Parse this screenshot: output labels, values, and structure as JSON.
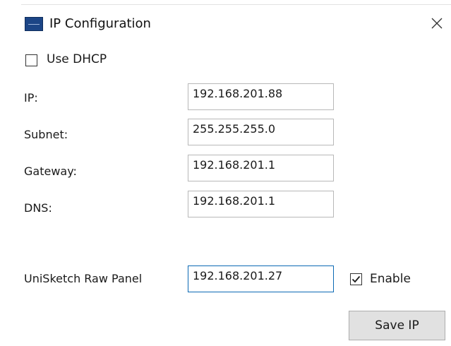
{
  "window": {
    "title": "IP Configuration",
    "icon": "app-logo-icon",
    "close_icon": "close-icon"
  },
  "dhcp": {
    "label": "Use DHCP",
    "checked": false
  },
  "fields": {
    "ip": {
      "label": "IP:",
      "value": "192.168.201.88"
    },
    "subnet": {
      "label": "Subnet:",
      "value": "255.255.255.0"
    },
    "gateway": {
      "label": "Gateway:",
      "value": "192.168.201.1"
    },
    "dns": {
      "label": "DNS:",
      "value": "192.168.201.1"
    },
    "unisketch": {
      "label": "UniSketch Raw Panel",
      "value": "192.168.201.27"
    }
  },
  "enable": {
    "label": "Enable",
    "checked": true
  },
  "save_button": {
    "label": "Save IP"
  },
  "colors": {
    "app_icon": "#1c4586",
    "focused_border": "#0b69b4",
    "button_bg": "#e1e1e1"
  }
}
